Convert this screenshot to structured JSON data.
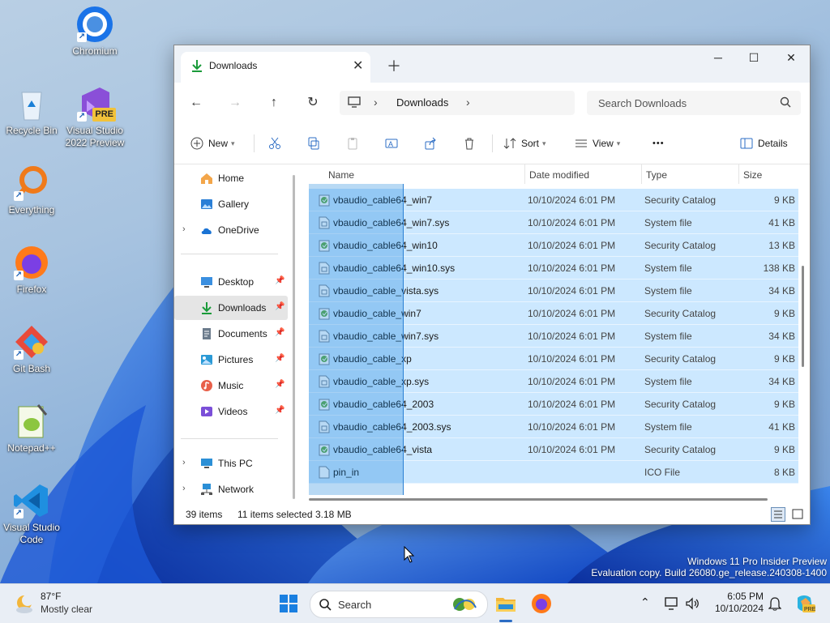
{
  "desktop": {
    "icons": [
      {
        "label": "Chromium"
      },
      {
        "label": "Recycle Bin"
      },
      {
        "label": "Visual Studio 2022 Preview",
        "badge": "PRE"
      },
      {
        "label": "Everything"
      },
      {
        "label": "Firefox"
      },
      {
        "label": "Git Bash"
      },
      {
        "label": "Notepad++"
      },
      {
        "label": "Visual Studio Code"
      }
    ],
    "watermark": {
      "line1": "Windows 11 Pro Insider Preview",
      "line2": "Evaluation copy. Build 26080.ge_release.240308-1400"
    }
  },
  "window": {
    "tab_title": "Downloads",
    "address": {
      "crumb": "Downloads"
    },
    "search_placeholder": "Search Downloads",
    "commands": {
      "new": "New",
      "sort": "Sort",
      "view": "View",
      "more": "•••",
      "details": "Details"
    },
    "nav": {
      "home": "Home",
      "gallery": "Gallery",
      "onedrive": "OneDrive",
      "desktop": "Desktop",
      "downloads": "Downloads",
      "documents": "Documents",
      "pictures": "Pictures",
      "music": "Music",
      "videos": "Videos",
      "thispc": "This PC",
      "network": "Network"
    },
    "columns": {
      "name": "Name",
      "date": "Date modified",
      "type": "Type",
      "size": "Size"
    },
    "files": [
      {
        "name": "vbaudio_cable64_win7",
        "date": "10/10/2024 6:01 PM",
        "type": "Security Catalog",
        "size": "9 KB",
        "icon": "catalog"
      },
      {
        "name": "vbaudio_cable64_win7.sys",
        "date": "10/10/2024 6:01 PM",
        "type": "System file",
        "size": "41 KB",
        "icon": "sys"
      },
      {
        "name": "vbaudio_cable64_win10",
        "date": "10/10/2024 6:01 PM",
        "type": "Security Catalog",
        "size": "13 KB",
        "icon": "catalog"
      },
      {
        "name": "vbaudio_cable64_win10.sys",
        "date": "10/10/2024 6:01 PM",
        "type": "System file",
        "size": "138 KB",
        "icon": "sys"
      },
      {
        "name": "vbaudio_cable_vista.sys",
        "date": "10/10/2024 6:01 PM",
        "type": "System file",
        "size": "34 KB",
        "icon": "sys"
      },
      {
        "name": "vbaudio_cable_win7",
        "date": "10/10/2024 6:01 PM",
        "type": "Security Catalog",
        "size": "9 KB",
        "icon": "catalog"
      },
      {
        "name": "vbaudio_cable_win7.sys",
        "date": "10/10/2024 6:01 PM",
        "type": "System file",
        "size": "34 KB",
        "icon": "sys"
      },
      {
        "name": "vbaudio_cable_xp",
        "date": "10/10/2024 6:01 PM",
        "type": "Security Catalog",
        "size": "9 KB",
        "icon": "catalog"
      },
      {
        "name": "vbaudio_cable_xp.sys",
        "date": "10/10/2024 6:01 PM",
        "type": "System file",
        "size": "34 KB",
        "icon": "sys"
      },
      {
        "name": "vbaudio_cable64_2003",
        "date": "10/10/2024 6:01 PM",
        "type": "Security Catalog",
        "size": "9 KB",
        "icon": "catalog"
      },
      {
        "name": "vbaudio_cable64_2003.sys",
        "date": "10/10/2024 6:01 PM",
        "type": "System file",
        "size": "41 KB",
        "icon": "sys"
      },
      {
        "name": "vbaudio_cable64_vista",
        "date": "10/10/2024 6:01 PM",
        "type": "Security Catalog",
        "size": "9 KB",
        "icon": "catalog"
      },
      {
        "name": "pin_in",
        "date": "",
        "type": "ICO File",
        "size": "8 KB",
        "icon": "ico"
      }
    ],
    "status": {
      "count": "39 items",
      "selected": "11 items selected",
      "size": "3.18 MB"
    }
  },
  "taskbar": {
    "weather": {
      "temp": "87°F",
      "desc": "Mostly clear"
    },
    "search_label": "Search",
    "clock": {
      "time": "6:05 PM",
      "date": "10/10/2024"
    }
  }
}
